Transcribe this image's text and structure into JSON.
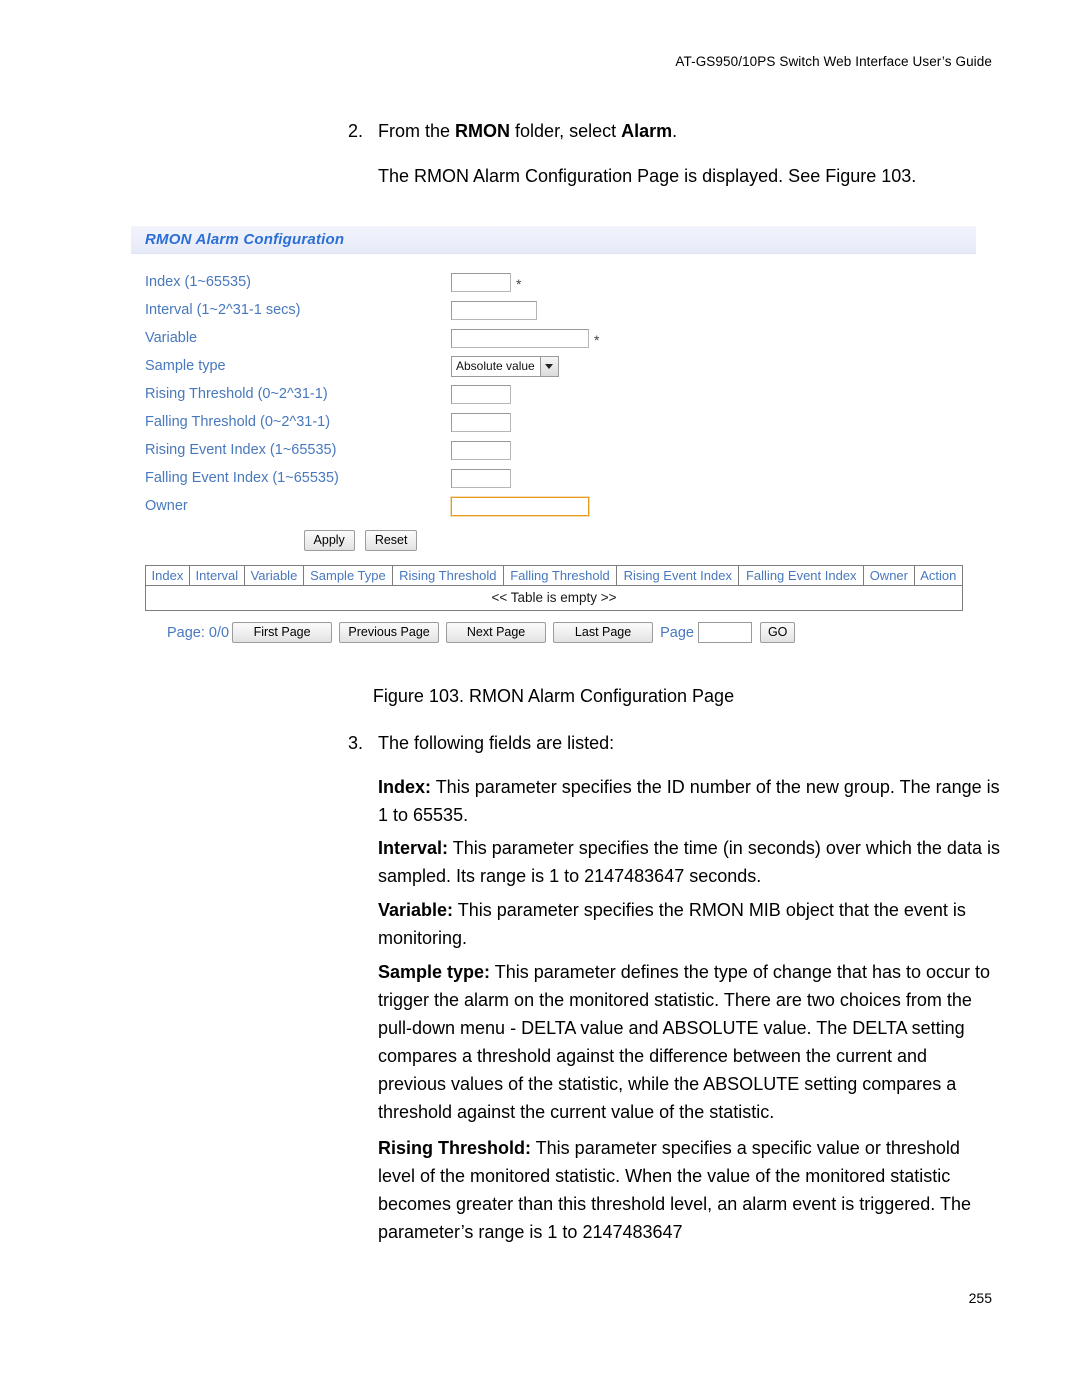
{
  "document": {
    "running_header": "AT-GS950/10PS Switch Web Interface User’s Guide",
    "page_number": "255"
  },
  "steps": {
    "step2": {
      "number": "2.",
      "text_before": "From the ",
      "bold1": "RMON",
      "text_middle": " folder, select ",
      "bold2": "Alarm",
      "text_after": "."
    },
    "displayed_note": "The RMON Alarm Configuration Page is displayed. See Figure 103.",
    "step3": {
      "number": "3.",
      "text": "The following fields are listed:"
    }
  },
  "figure": {
    "caption": "Figure 103. RMON Alarm Configuration Page"
  },
  "panel": {
    "title": "RMON Alarm Configuration",
    "fields": [
      {
        "label": "Index (1~65535)",
        "value": "",
        "required_mark": "*",
        "width": "sm"
      },
      {
        "label": "Interval (1~2^31-1 secs)",
        "value": "",
        "required_mark": "",
        "width": "md"
      },
      {
        "label": "Variable",
        "value": "",
        "required_mark": "*",
        "width": "lg"
      },
      {
        "label": "Sample type",
        "value": "Absolute value",
        "required_mark": "",
        "width": "select"
      },
      {
        "label": "Rising Threshold (0~2^31-1)",
        "value": "",
        "required_mark": "",
        "width": "sm"
      },
      {
        "label": "Falling Threshold (0~2^31-1)",
        "value": "",
        "required_mark": "",
        "width": "sm"
      },
      {
        "label": "Rising Event Index (1~65535)",
        "value": "",
        "required_mark": "",
        "width": "sm"
      },
      {
        "label": "Falling Event Index (1~65535)",
        "value": "",
        "required_mark": "",
        "width": "sm"
      },
      {
        "label": "Owner",
        "value": "",
        "required_mark": "",
        "width": "owner"
      }
    ],
    "sample_type_options": [
      "Absolute value",
      "Delta value"
    ],
    "buttons": {
      "apply": "Apply",
      "reset": "Reset"
    },
    "table": {
      "headers": [
        "Index",
        "Interval",
        "Variable",
        "Sample Type",
        "Rising Threshold",
        "Falling Threshold",
        "Rising Event Index",
        "Falling Event Index",
        "Owner",
        "Action"
      ],
      "rows": [],
      "empty_message": "<< Table is empty >>"
    },
    "pagination": {
      "page_status": "Page: 0/0",
      "first": "First Page",
      "previous": "Previous Page",
      "next": "Next Page",
      "last": "Last Page",
      "page_label": "Page",
      "page_value": "",
      "go": "GO"
    },
    "colors": {
      "label_blue": "#4878bd",
      "title_blue": "#2b6fd6",
      "focus_orange": "#e59b1e",
      "header_bg": "#eceffa"
    }
  },
  "field_descriptions": [
    {
      "term": "Index:",
      "text": " This parameter specifies the ID number of the new group. The range is 1 to 65535."
    },
    {
      "term": "Interval:",
      "text": " This parameter specifies the time (in seconds) over which the data is sampled. Its range is 1 to 2147483647 seconds."
    },
    {
      "term": "Variable:",
      "text": " This parameter specifies the RMON MIB object that the event is monitoring."
    },
    {
      "term": "Sample type:",
      "text": " This parameter defines the type of change that has to occur to trigger the alarm on the monitored statistic. There are two choices from the pull-down menu - DELTA value and ABSOLUTE value. The DELTA setting compares a threshold against the difference between the current and previous values of the statistic, while the ABSOLUTE setting compares a threshold against the current value of the statistic."
    },
    {
      "term": "Rising Threshold:",
      "text": " This parameter specifies a specific value or threshold level of the monitored statistic. When the value of the monitored statistic becomes greater than this threshold level, an alarm event is triggered. The parameter’s range is 1 to 2147483647"
    }
  ]
}
